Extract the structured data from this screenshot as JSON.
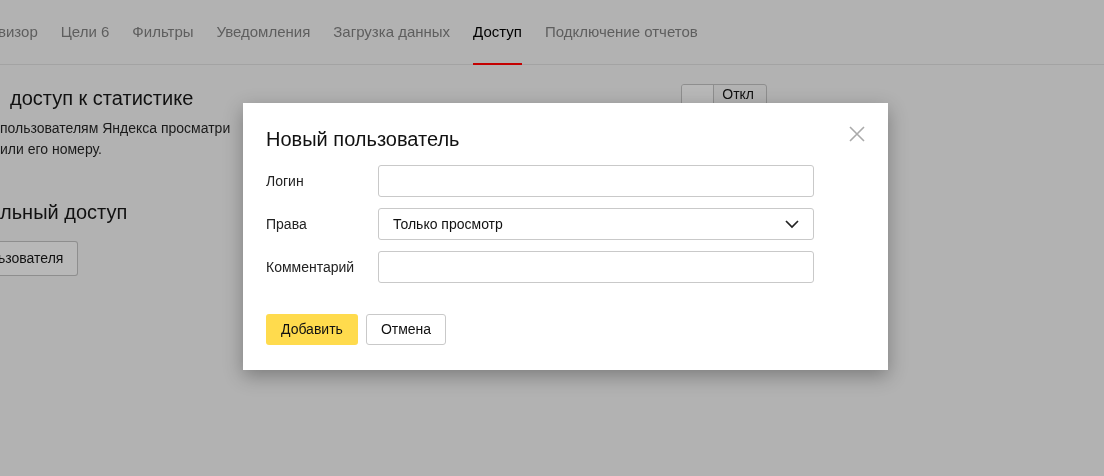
{
  "tabs": [
    {
      "label": "визор",
      "selected": false
    },
    {
      "label": "Цели 6",
      "selected": false
    },
    {
      "label": "Фильтры",
      "selected": false
    },
    {
      "label": "Уведомления",
      "selected": false
    },
    {
      "label": "Загрузка данных",
      "selected": false
    },
    {
      "label": "Доступ",
      "selected": true
    },
    {
      "label": "Подключение отчетов",
      "selected": false
    }
  ],
  "public_access": {
    "title": "доступ к статистике",
    "toggle": {
      "label": "Откл",
      "on": false
    },
    "description": [
      "пользователям Яндекса просматри",
      "или его номеру."
    ]
  },
  "personal_access": {
    "title": "льный доступ",
    "button": "ьзователя"
  },
  "dialog": {
    "title": "Новый пользователь",
    "fields": [
      {
        "kind": "text",
        "label": "Логин"
      },
      {
        "kind": "select",
        "label": "Права",
        "value": "Только просмотр"
      },
      {
        "kind": "text",
        "label": "Комментарий"
      }
    ],
    "buttons": [
      {
        "label": "Добавить",
        "kind": "primary"
      },
      {
        "label": "Отмена",
        "kind": "secondary"
      }
    ]
  }
}
